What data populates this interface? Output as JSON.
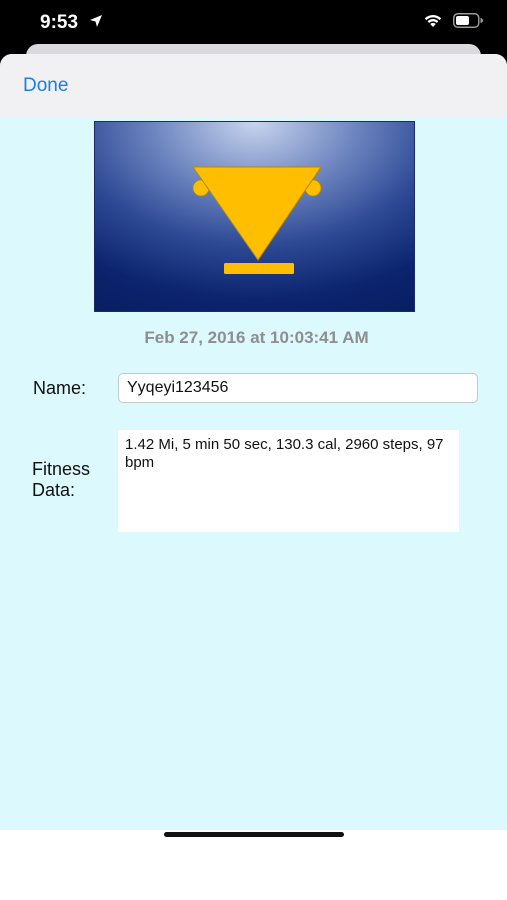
{
  "status_bar": {
    "time": "9:53",
    "icons": [
      "location-arrow-icon",
      "wifi-icon",
      "battery-icon"
    ]
  },
  "nav": {
    "done_label": "Done",
    "accent_color": "#1a7fe0"
  },
  "photo": {
    "subject": "trophy-icon",
    "trophy_color": "#ffbf00"
  },
  "entry": {
    "date": "Feb 27, 2016 at 10:03:41 AM",
    "name_label": "Name:",
    "name_value": "Yyqeyi123456",
    "fitness_label_line1": "Fitness",
    "fitness_label_line2": "Data:",
    "fitness_value": "1.42 Mi, 5 min 50 sec, 130.3 cal, 2960 steps, 97 bpm"
  },
  "colors": {
    "content_background": "#dcf9fd",
    "date_text": "#8e8e8e"
  }
}
